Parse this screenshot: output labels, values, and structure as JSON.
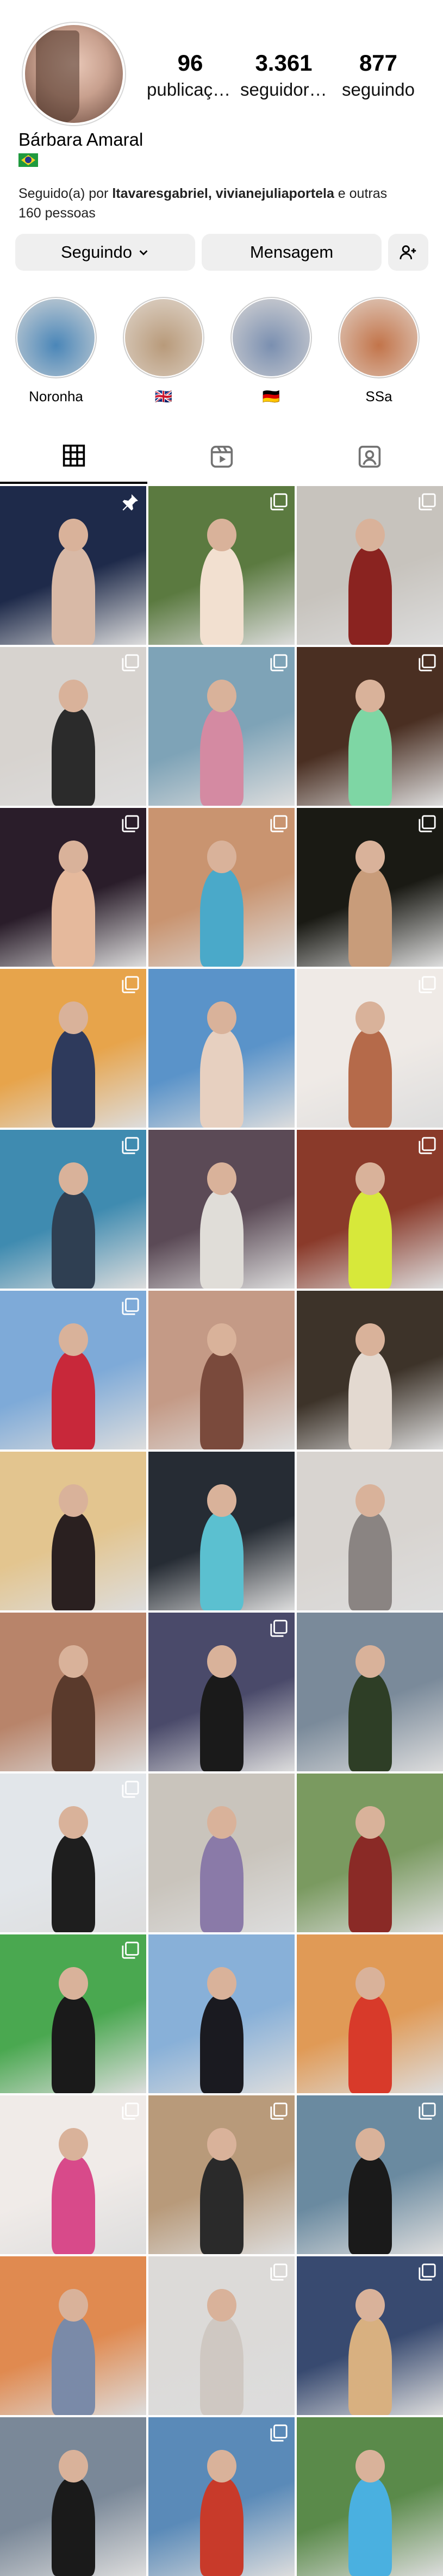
{
  "profile": {
    "name": "Bárbara Amaral",
    "flag_icon": "brazil-flag-icon",
    "stats": [
      {
        "value": "96",
        "label": "publicaçõ..."
      },
      {
        "value": "3.361",
        "label": "seguidores"
      },
      {
        "value": "877",
        "label": "seguindo"
      }
    ],
    "followed_prefix": "Seguido(a) por ",
    "followed_names": "ltavaresgabriel, vivianejuliaportela",
    "followed_suffix": " e outras 160 pessoas"
  },
  "actions": {
    "following_label": "Seguindo",
    "message_label": "Mensagem",
    "add_friend_icon": "add-person-icon"
  },
  "highlights": [
    {
      "label": "Noronha",
      "color": "#4a86b8"
    },
    {
      "label": "🇬🇧",
      "color": "#b89a7a"
    },
    {
      "label": "🇩🇪",
      "color": "#7a8fb0"
    },
    {
      "label": "SSa",
      "color": "#c2744a"
    }
  ],
  "tabs": [
    {
      "icon": "grid-icon",
      "active": true
    },
    {
      "icon": "reels-icon",
      "active": false
    },
    {
      "icon": "tagged-icon",
      "active": false
    }
  ],
  "posts": [
    {
      "bg": "#1e2a4a",
      "fg": "#d8b9a6",
      "badge": "pin"
    },
    {
      "bg": "#5b7a40",
      "fg": "#f2e0d0",
      "badge": "multi"
    },
    {
      "bg": "#c7c3bd",
      "fg": "#8a2320",
      "badge": "multi"
    },
    {
      "bg": "#d7d3cf",
      "fg": "#2b2b2b",
      "badge": "multi"
    },
    {
      "bg": "#7ea3b7",
      "fg": "#d48aa2",
      "badge": "multi"
    },
    {
      "bg": "#4a2f22",
      "fg": "#7ed6a4",
      "badge": "multi"
    },
    {
      "bg": "#2a1d2a",
      "fg": "#e5b99c",
      "badge": "multi"
    },
    {
      "bg": "#c99470",
      "fg": "#4aa9c9",
      "badge": "multi"
    },
    {
      "bg": "#1a1a14",
      "fg": "#c89c7a",
      "badge": "multi"
    },
    {
      "bg": "#e7a44b",
      "fg": "#2e3a5c",
      "badge": "multi"
    },
    {
      "bg": "#5a93c9",
      "fg": "#e7d0c0",
      "badge": "none"
    },
    {
      "bg": "#efeae6",
      "fg": "#b56a4a",
      "badge": "multi"
    },
    {
      "bg": "#3f8bb0",
      "fg": "#2f3f52",
      "badge": "multi"
    },
    {
      "bg": "#5b4a56",
      "fg": "#e0ddd8",
      "badge": "none"
    },
    {
      "bg": "#8a3a2a",
      "fg": "#d7e83a",
      "badge": "multi"
    },
    {
      "bg": "#7eaad8",
      "fg": "#c8283a",
      "badge": "multi"
    },
    {
      "bg": "#c49a86",
      "fg": "#7a4a3c",
      "badge": "none"
    },
    {
      "bg": "#3d3329",
      "fg": "#e3d9d0",
      "badge": "none"
    },
    {
      "bg": "#e3c58f",
      "fg": "#2a2020",
      "badge": "none"
    },
    {
      "bg": "#262c34",
      "fg": "#5bc0d0",
      "badge": "none"
    },
    {
      "bg": "#d8d4d0",
      "fg": "#8a8482",
      "badge": "none"
    },
    {
      "bg": "#b8846a",
      "fg": "#5a3a2c",
      "badge": "none"
    },
    {
      "bg": "#4a4a6a",
      "fg": "#1a1a1a",
      "badge": "multi"
    },
    {
      "bg": "#7a8a9a",
      "fg": "#2e3e26",
      "badge": "none"
    },
    {
      "bg": "#e2e6ea",
      "fg": "#1e1e1e",
      "badge": "multi"
    },
    {
      "bg": "#c9c4bc",
      "fg": "#8a7aa8",
      "badge": "none"
    },
    {
      "bg": "#7a9a60",
      "fg": "#8a2a26",
      "badge": "none"
    },
    {
      "bg": "#4aa850",
      "fg": "#1a1a1a",
      "badge": "multi"
    },
    {
      "bg": "#88b0d8",
      "fg": "#1a1a20",
      "badge": "none"
    },
    {
      "bg": "#e09a56",
      "fg": "#d83a2a",
      "badge": "none"
    },
    {
      "bg": "#f0ebe8",
      "fg": "#d84a8a",
      "badge": "multi"
    },
    {
      "bg": "#b89a7a",
      "fg": "#2a2a2a",
      "badge": "multi"
    },
    {
      "bg": "#6a8aa0",
      "fg": "#1a1a1a",
      "badge": "multi"
    },
    {
      "bg": "#e08a50",
      "fg": "#7a8aa8",
      "badge": "none"
    },
    {
      "bg": "#dcdad8",
      "fg": "#cfc8c2",
      "badge": "multi"
    },
    {
      "bg": "#384a70",
      "fg": "#d8b080",
      "badge": "multi"
    },
    {
      "bg": "#7a8898",
      "fg": "#1a1a1a",
      "badge": "none"
    },
    {
      "bg": "#5a8ab8",
      "fg": "#c83a2a",
      "badge": "multi"
    },
    {
      "bg": "#5a8a4a",
      "fg": "#4ab0e0",
      "badge": "none"
    }
  ]
}
